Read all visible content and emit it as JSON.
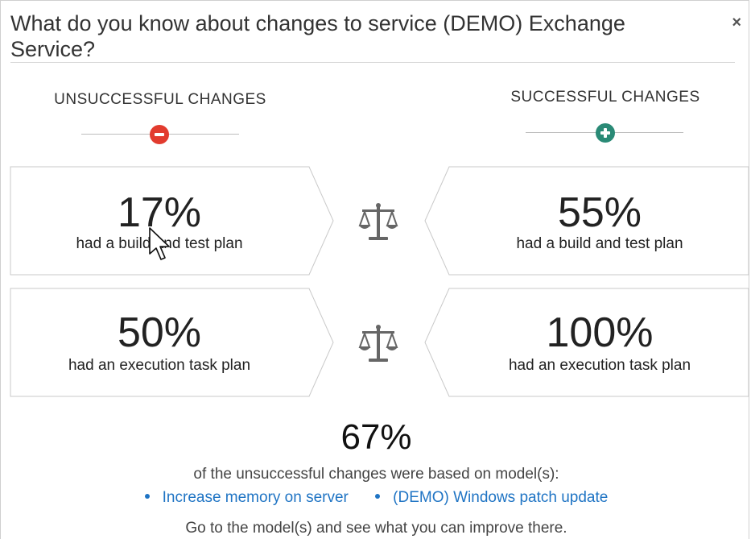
{
  "dialog": {
    "title": "What do you know about changes to service (DEMO) Exchange Service?",
    "close_label": "×"
  },
  "columns": {
    "left_heading": "UNSUCCESSFUL CHANGES",
    "right_heading": "SUCCESSFUL CHANGES",
    "left_icon": "minus-circle-icon",
    "right_icon": "plus-circle-icon",
    "colors": {
      "minus": "#e23b2e",
      "plus": "#2a8a76",
      "link": "#1f74c4"
    }
  },
  "comparisons": [
    {
      "left": {
        "percent": "17%",
        "text": "had a build and test plan"
      },
      "right": {
        "percent": "55%",
        "text": "had a build and test plan"
      },
      "icon": "balance-scale-icon"
    },
    {
      "left": {
        "percent": "50%",
        "text": "had an execution task plan"
      },
      "right": {
        "percent": "100%",
        "text": "had an execution task plan"
      },
      "icon": "balance-scale-icon"
    }
  ],
  "summary": {
    "percent": "67%",
    "text": "of the unsuccessful changes were based on model(s):",
    "models": [
      "Increase memory on server",
      "(DEMO) Windows patch update"
    ],
    "footer": "Go to the model(s) and see what you can improve there."
  }
}
